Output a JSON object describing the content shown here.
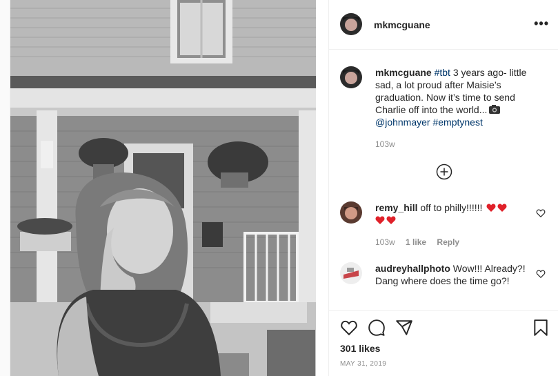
{
  "post": {
    "author": "mkmcguane",
    "caption": {
      "hashtag1": "#tbt",
      "text1": " 3 years ago- little sad, a lot proud after Maisie’s graduation. Now it’s time to send Charlie off into the world...",
      "mention": "@johnmayer",
      "hashtag2": "#emptynest",
      "time": "103w"
    },
    "likes": "301 likes",
    "date": "MAY 31, 2019"
  },
  "comments": [
    {
      "user": "remy_hill",
      "text": "off to philly!!!!!!",
      "time": "103w",
      "likes": "1 like",
      "reply": "Reply",
      "hearts": 4
    },
    {
      "user": "audreyhallphoto",
      "text": "Wow!!! Already?! Dang where does the time go?!"
    }
  ],
  "icons": {
    "more": "more-options-icon",
    "plus": "load-more-comments-icon",
    "like": "heart-icon",
    "comment": "comment-icon",
    "share": "share-icon",
    "save": "bookmark-icon"
  },
  "colors": {
    "link": "#00376b",
    "heart": "#ed1c24",
    "muted": "#8e8e8e"
  }
}
